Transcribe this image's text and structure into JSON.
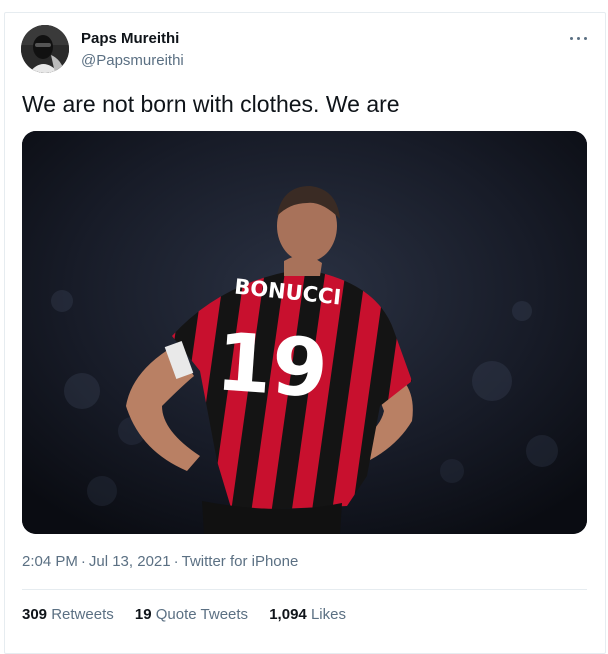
{
  "tweet": {
    "author_name": "Paps Mureithi",
    "author_handle": "@Papsmureithi",
    "text": "We are not born with clothes. We are",
    "time": "2:04 PM",
    "date": "Jul 13, 2021",
    "source": "Twitter for iPhone",
    "separator": "·"
  },
  "photo": {
    "jersey_name": "BONUCCI",
    "jersey_number": "19"
  },
  "stats": [
    {
      "count": "309",
      "label": "Retweets"
    },
    {
      "count": "19",
      "label": "Quote Tweets"
    },
    {
      "count": "1,094",
      "label": "Likes"
    }
  ],
  "icons": {
    "more": "more-horizontal-icon"
  },
  "colors": {
    "text": "#0f1419",
    "secondary": "#5b7083",
    "border": "#e6ecf0",
    "jersey_red": "#c8102e",
    "jersey_black": "#111111"
  }
}
